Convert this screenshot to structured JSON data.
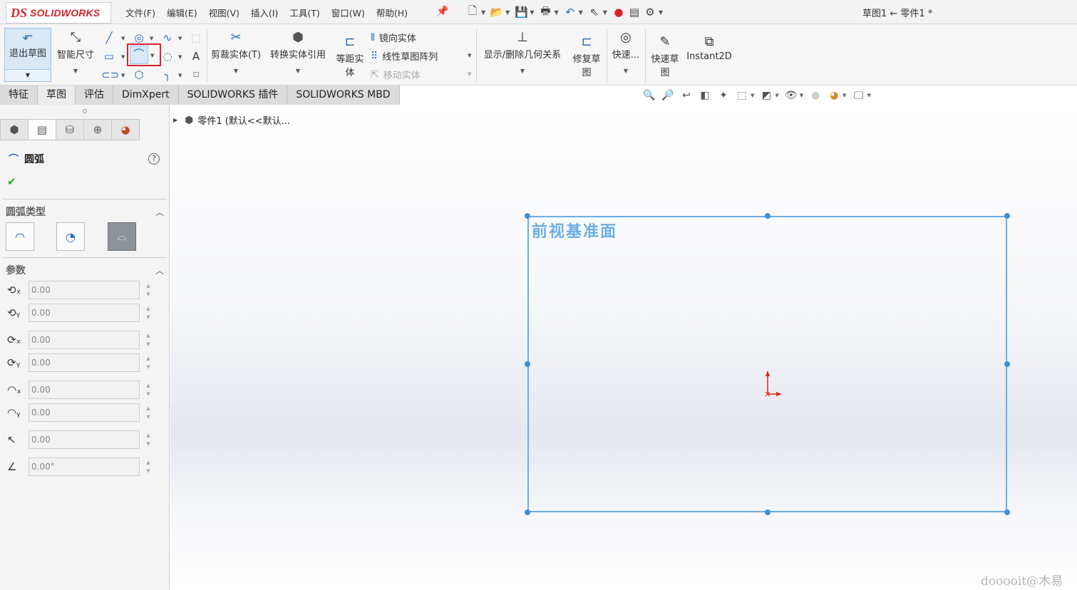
{
  "app": {
    "logo_ds": "DS",
    "logo_word": "SOLIDWORKS",
    "doc_title": "草图1 ← 零件1 *"
  },
  "menu": [
    "文件(F)",
    "编辑(E)",
    "视图(V)",
    "插入(I)",
    "工具(T)",
    "窗口(W)",
    "帮助(H)"
  ],
  "ribbon": {
    "exit_sketch": "退出草图",
    "smart_dim": "智能尺寸",
    "trim": "剪裁实体(T)",
    "convert": "转换实体引用",
    "offset_l1": "等距实",
    "offset_l2": "体",
    "mirror": "镜向实体",
    "linear_pattern": "线性草图阵列",
    "move": "移动实体",
    "relations": "显示/删除几何关系",
    "repair_l1": "修复草",
    "repair_l2": "图",
    "quick_snaps": "快速...",
    "rapid_l1": "快速草",
    "rapid_l2": "图",
    "instant2d": "Instant2D"
  },
  "tabs": [
    "特征",
    "草图",
    "评估",
    "DimXpert",
    "SOLIDWORKS 插件",
    "SOLIDWORKS MBD"
  ],
  "active_tab": "草图",
  "panel": {
    "title": "圆弧",
    "help": "?",
    "arc_type_header": "圆弧类型",
    "params_header": "参数",
    "params": [
      "0.00",
      "0.00",
      "0.00",
      "0.00",
      "0.00",
      "0.00",
      "0.00",
      "0.00°"
    ]
  },
  "tree": {
    "label": "零件1  (默认<<默认..."
  },
  "graphics": {
    "plane_label": "前视基准面",
    "watermark": "dooooit@木易"
  },
  "colors": {
    "accent": "#2f6fb3",
    "plane": "#6aaee6",
    "highlight": "#d9232b",
    "brand": "#d2232a"
  }
}
